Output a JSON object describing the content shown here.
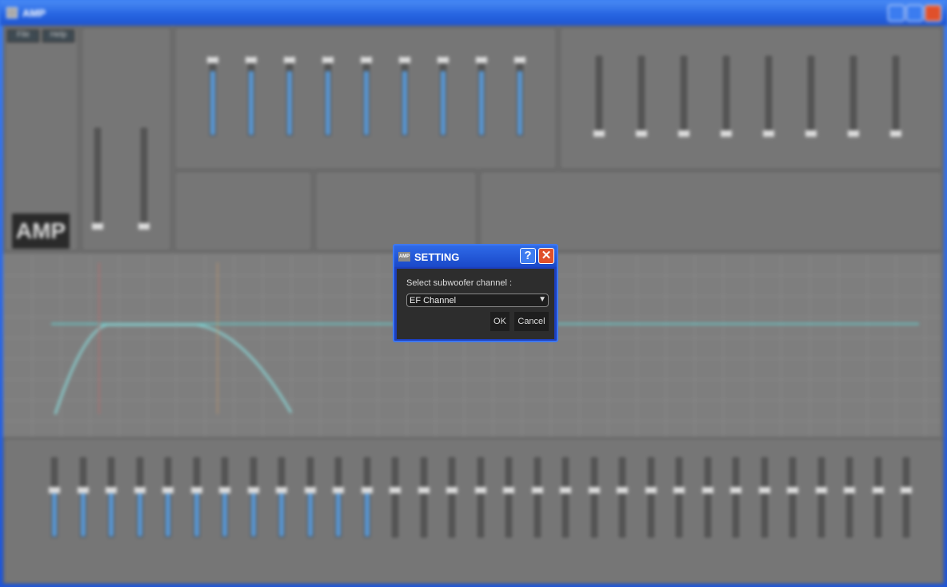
{
  "window": {
    "title": "AMP"
  },
  "menu": {
    "file": "File",
    "help": "Help"
  },
  "logo": "AMP",
  "dialog": {
    "icon_text": "AMP",
    "title": "SETTING",
    "help": "?",
    "close": "✕",
    "label": "Select subwoofer channel :",
    "selected": "EF Channel",
    "ok": "OK",
    "cancel": "Cancel"
  }
}
